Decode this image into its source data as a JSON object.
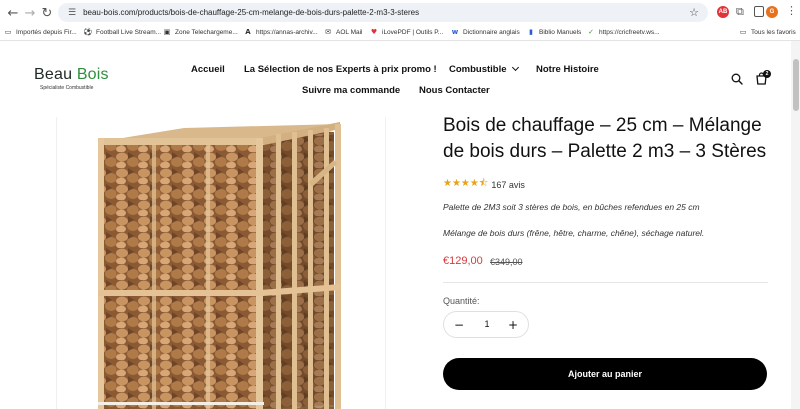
{
  "browser": {
    "url": "beau-bois.com/products/bois-de-chauffage-25-cm-melange-de-bois-durs-palette-2-m3-3-steres",
    "profile_initial": "G",
    "bookmarks": [
      {
        "label": "Importés depuis Fir...",
        "icon": "folder-icon"
      },
      {
        "label": "Football Live Stream...",
        "icon": "stream-icon"
      },
      {
        "label": "Zone Telechargeme...",
        "icon": "download-icon"
      },
      {
        "label": "https://annas-archiv...",
        "icon": "annas-icon"
      },
      {
        "label": "AOL Mail",
        "icon": "mail-icon"
      },
      {
        "label": "iLovePDF | Outils P...",
        "icon": "ilovepdf-icon"
      },
      {
        "label": "Dictionnaire anglais",
        "icon": "wr-icon"
      },
      {
        "label": "Biblio Manuels",
        "icon": "book-icon"
      },
      {
        "label": "https://cricfreetv.ws...",
        "icon": "check-icon"
      },
      {
        "label": "Tous les favoris",
        "icon": "folder-icon"
      }
    ]
  },
  "site": {
    "brand_part1": "Beau ",
    "brand_part2": "Bois",
    "tagline": "Spécialiste Combustible",
    "nav": [
      "Accueil",
      "La Sélection de nos Experts à prix promo !",
      "Combustible",
      "Notre Histoire",
      "Suivre ma commande",
      "Nous Contacter"
    ],
    "cart_count": "2",
    "colors": {
      "accent_green": "#2f8f3e",
      "sale_red": "#d63b3b",
      "star": "#e8a317"
    }
  },
  "product": {
    "title": "Bois de chauffage – 25 cm – Mélange de bois durs – Palette 2 m3 – 3 Stères",
    "rating": 4.5,
    "rating_stars": "★★★★⯪",
    "reviews": "167 avis",
    "desc1": "Palette de 2M3 soit 3 stères de bois, en bûches refendues en 25 cm",
    "desc2": "Mélange de bois durs (frêne, hêtre, charme, chêne), séchage naturel.",
    "price": "€129,00",
    "old_price": "€349,00",
    "quantity_label": "Quantité:",
    "quantity": "1",
    "minus": "−",
    "plus": "+",
    "add_to_cart": "Ajouter au panier"
  }
}
